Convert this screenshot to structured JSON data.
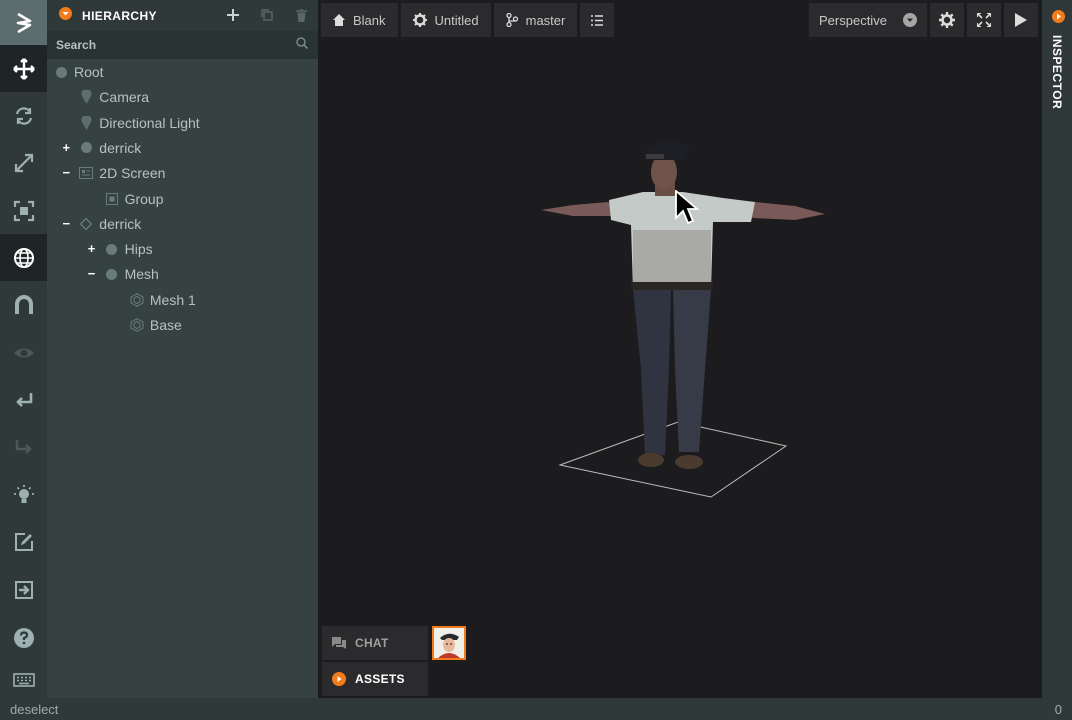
{
  "toolbar": {
    "items": [
      "logo-icon",
      "move-icon",
      "rotate-icon",
      "scale-icon",
      "resize-icon",
      "world-icon",
      "magnet-icon",
      "eye-icon",
      "undo-icon",
      "redo-icon",
      "light-icon",
      "edit-icon",
      "publish-icon",
      "help-icon",
      "keyboard-icon"
    ]
  },
  "hierarchy": {
    "title": "HIERARCHY",
    "search_placeholder": "Search",
    "items": [
      {
        "label": "Root",
        "depth": 0,
        "icon": "entity-dot",
        "expander": ""
      },
      {
        "label": "Camera",
        "depth": 1,
        "icon": "camera-pin",
        "expander": ""
      },
      {
        "label": "Directional Light",
        "depth": 1,
        "icon": "light-pin",
        "expander": ""
      },
      {
        "label": "derrick",
        "depth": 1,
        "icon": "entity-dot",
        "expander": "+"
      },
      {
        "label": "2D Screen",
        "depth": 1,
        "icon": "screen-icon",
        "expander": "−"
      },
      {
        "label": "Group",
        "depth": 2,
        "icon": "group-icon",
        "expander": ""
      },
      {
        "label": "derrick",
        "depth": 1,
        "icon": "model-icon",
        "expander": "−"
      },
      {
        "label": "Hips",
        "depth": 2,
        "icon": "entity-dot",
        "expander": "+"
      },
      {
        "label": "Mesh",
        "depth": 2,
        "icon": "entity-dot",
        "expander": "−"
      },
      {
        "label": "Mesh 1",
        "depth": 3,
        "icon": "mesh-icon",
        "expander": ""
      },
      {
        "label": "Base",
        "depth": 3,
        "icon": "mesh-icon",
        "expander": ""
      }
    ]
  },
  "viewport": {
    "project_label": "Blank",
    "scene_label": "Untitled",
    "branch_label": "master",
    "camera_label": "Perspective"
  },
  "bottom": {
    "chat_label": "CHAT",
    "assets_label": "ASSETS"
  },
  "inspector": {
    "label": "INSPECTOR"
  },
  "status": {
    "text": "deselect",
    "count": "0"
  },
  "colors": {
    "accent": "#f27b1b",
    "panel": "#364242",
    "toolbar": "#2f3939",
    "viewport": "#1c1b1e"
  }
}
